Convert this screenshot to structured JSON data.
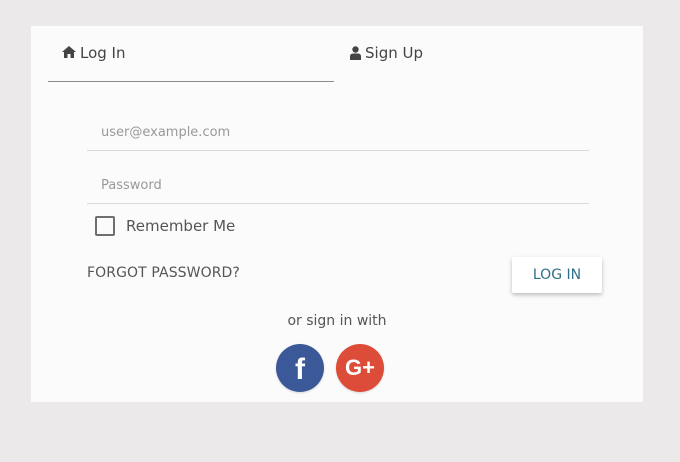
{
  "tabs": {
    "login": "Log In",
    "signup": "Sign Up"
  },
  "form": {
    "email_placeholder": "user@example.com",
    "password_placeholder": "Password",
    "remember_label": "Remember Me",
    "remember_checked": false,
    "forgot_label": "FORGOT PASSWORD?",
    "login_button": "LOG IN"
  },
  "social": {
    "or_text": "or sign in with",
    "facebook_icon": "facebook-icon",
    "googleplus_icon": "google-plus-icon"
  },
  "colors": {
    "background": "#ebe9e9",
    "card": "#fbfbfb",
    "accent": "#2f6f88",
    "facebook": "#3b5998",
    "googleplus": "#dd4b39"
  }
}
